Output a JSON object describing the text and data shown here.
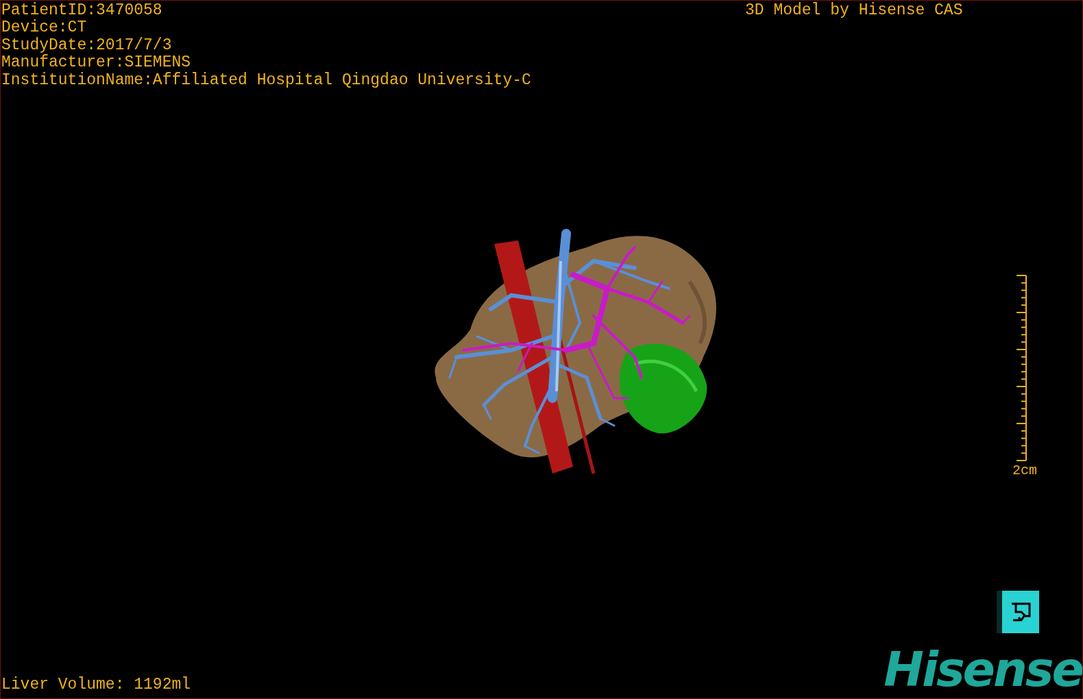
{
  "patient_info": [
    "PatientID:3470058",
    "Device:CT",
    "StudyDate:2017/7/3",
    "Manufacturer:SIEMENS",
    "InstitutionName:Affiliated Hospital Qingdao University-C"
  ],
  "credit": "3D Model by Hisense CAS",
  "scale_bar": {
    "label": "2cm"
  },
  "liver_volume": "Liver Volume: 1192ml",
  "logo": "Hisense"
}
